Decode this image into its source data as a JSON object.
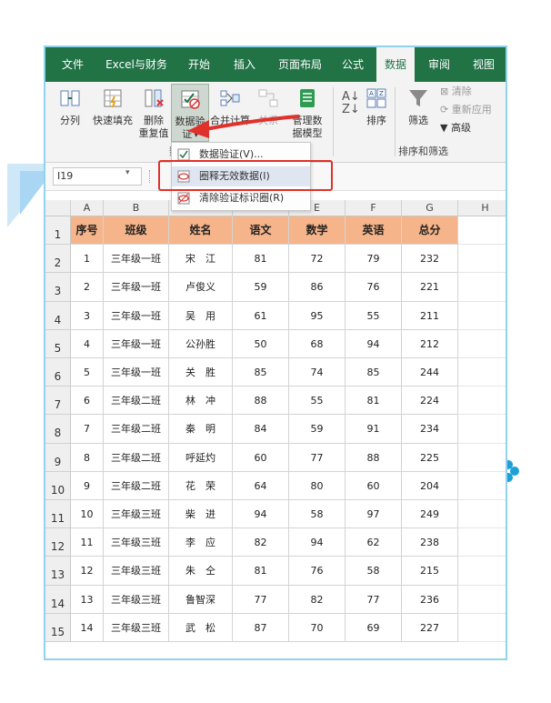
{
  "tabs": [
    "文件",
    "Excel与财务",
    "开始",
    "插入",
    "页面布局",
    "公式",
    "数据",
    "审阅",
    "视图"
  ],
  "active_tab": "数据",
  "ribbon": {
    "split": "分列",
    "flash_fill": "快速填充",
    "remove_dup_1": "删除",
    "remove_dup_2": "重复值",
    "data_validation_1": "数据验",
    "data_validation_2": "证",
    "consolidate": "合并计算",
    "relations": "关系",
    "data_model_1": "管理数",
    "data_model_2": "据模型",
    "sort": "排序",
    "filter": "筛选",
    "clear": "清除",
    "reapply": "重新应用",
    "advanced": "高级",
    "group_sort_filter": "排序和筛选",
    "group_data_tools": "数"
  },
  "name_box": "I19",
  "dropdown": {
    "items": [
      "数据验证(V)...",
      "圈释无效数据(I)",
      "清除验证标识圈(R)"
    ],
    "highlighted_index": 1
  },
  "columns": [
    "A",
    "B",
    "C",
    "D",
    "E",
    "F",
    "G",
    "H"
  ],
  "headers": [
    "序号",
    "班级",
    "姓名",
    "语文",
    "数学",
    "英语",
    "总分"
  ],
  "rows": [
    [
      "1",
      "三年级一班",
      "宋　江",
      "81",
      "72",
      "79",
      "232"
    ],
    [
      "2",
      "三年级一班",
      "卢俊义",
      "59",
      "86",
      "76",
      "221"
    ],
    [
      "3",
      "三年级一班",
      "吴　用",
      "61",
      "95",
      "55",
      "211"
    ],
    [
      "4",
      "三年级一班",
      "公孙胜",
      "50",
      "68",
      "94",
      "212"
    ],
    [
      "5",
      "三年级一班",
      "关　胜",
      "85",
      "74",
      "85",
      "244"
    ],
    [
      "6",
      "三年级二班",
      "林　冲",
      "88",
      "55",
      "81",
      "224"
    ],
    [
      "7",
      "三年级二班",
      "秦　明",
      "84",
      "59",
      "91",
      "234"
    ],
    [
      "8",
      "三年级二班",
      "呼延灼",
      "60",
      "77",
      "88",
      "225"
    ],
    [
      "9",
      "三年级二班",
      "花　荣",
      "64",
      "80",
      "60",
      "204"
    ],
    [
      "10",
      "三年级三班",
      "柴　进",
      "94",
      "58",
      "97",
      "249"
    ],
    [
      "11",
      "三年级三班",
      "李　应",
      "82",
      "94",
      "62",
      "238"
    ],
    [
      "12",
      "三年级三班",
      "朱　仝",
      "81",
      "76",
      "58",
      "215"
    ],
    [
      "13",
      "三年级三班",
      "鲁智深",
      "77",
      "82",
      "77",
      "236"
    ],
    [
      "14",
      "三年级三班",
      "武　松",
      "87",
      "70",
      "69",
      "227"
    ]
  ],
  "row_numbers": [
    "1",
    "2",
    "3",
    "4",
    "5",
    "6",
    "7",
    "8",
    "9",
    "10",
    "11",
    "12",
    "13",
    "14",
    "15"
  ],
  "colors": {
    "excel_green": "#217346",
    "header_fill": "#f6b48a",
    "highlight_red": "#e0312a"
  }
}
